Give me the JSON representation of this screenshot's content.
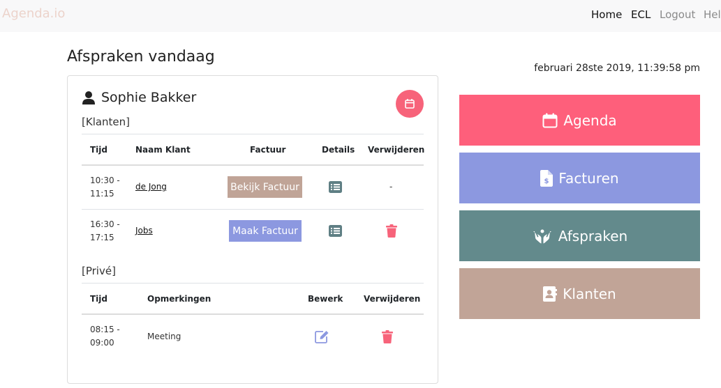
{
  "navbar": {
    "brand": "Agenda.io",
    "items": [
      {
        "label": "Home",
        "active": true
      },
      {
        "label": "ECL",
        "active": true
      },
      {
        "label": "Logout",
        "active": false
      },
      {
        "label": "Hell",
        "active": false
      }
    ]
  },
  "page": {
    "title": "Afspraken vandaag",
    "datetime": "februari 28ste 2019, 11:39:58 pm"
  },
  "card": {
    "person_name": "Sophie Bakker",
    "calendar_icon": "calendar-icon",
    "clients_section": {
      "label": "[Klanten]",
      "headers": [
        "Tijd",
        "Naam Klant",
        "Factuur",
        "Details",
        "Verwijderen"
      ],
      "rows": [
        {
          "time_start": "10:30 -",
          "time_end": "11:15",
          "client": "de Jong",
          "invoice_label": "Bekijk Factuur",
          "invoice_color": "#c0a497",
          "details_icon": "list-icon",
          "delete": "-"
        },
        {
          "time_start": "16:30 -",
          "time_end": "17:15",
          "client": "Jobs",
          "invoice_label": "Maak Factuur",
          "invoice_color": "#8c98e0",
          "details_icon": "list-icon",
          "delete_icon": "trash-icon"
        }
      ]
    },
    "private_section": {
      "label": "[Privé]",
      "headers": [
        "Tijd",
        "Opmerkingen",
        "Bewerk",
        "Verwijderen"
      ],
      "rows": [
        {
          "time_start": "08:15 -",
          "time_end": "09:00",
          "note": "Meeting",
          "edit_icon": "edit-icon",
          "delete_icon": "trash-icon"
        }
      ]
    }
  },
  "menu": [
    {
      "label": "Agenda",
      "icon": "calendar-icon",
      "color": "#fe5f7b"
    },
    {
      "label": "Facturen",
      "icon": "invoice-icon",
      "color": "#8c98e0"
    },
    {
      "label": "Afspraken",
      "icon": "hands-icon",
      "color": "#638a8c"
    },
    {
      "label": "Klanten",
      "icon": "contact-card-icon",
      "color": "#c1a497"
    }
  ],
  "colors": {
    "accent_pink": "#f7637a",
    "icon_slate": "#5f7f84",
    "icon_periwinkle": "#8c98e0"
  }
}
